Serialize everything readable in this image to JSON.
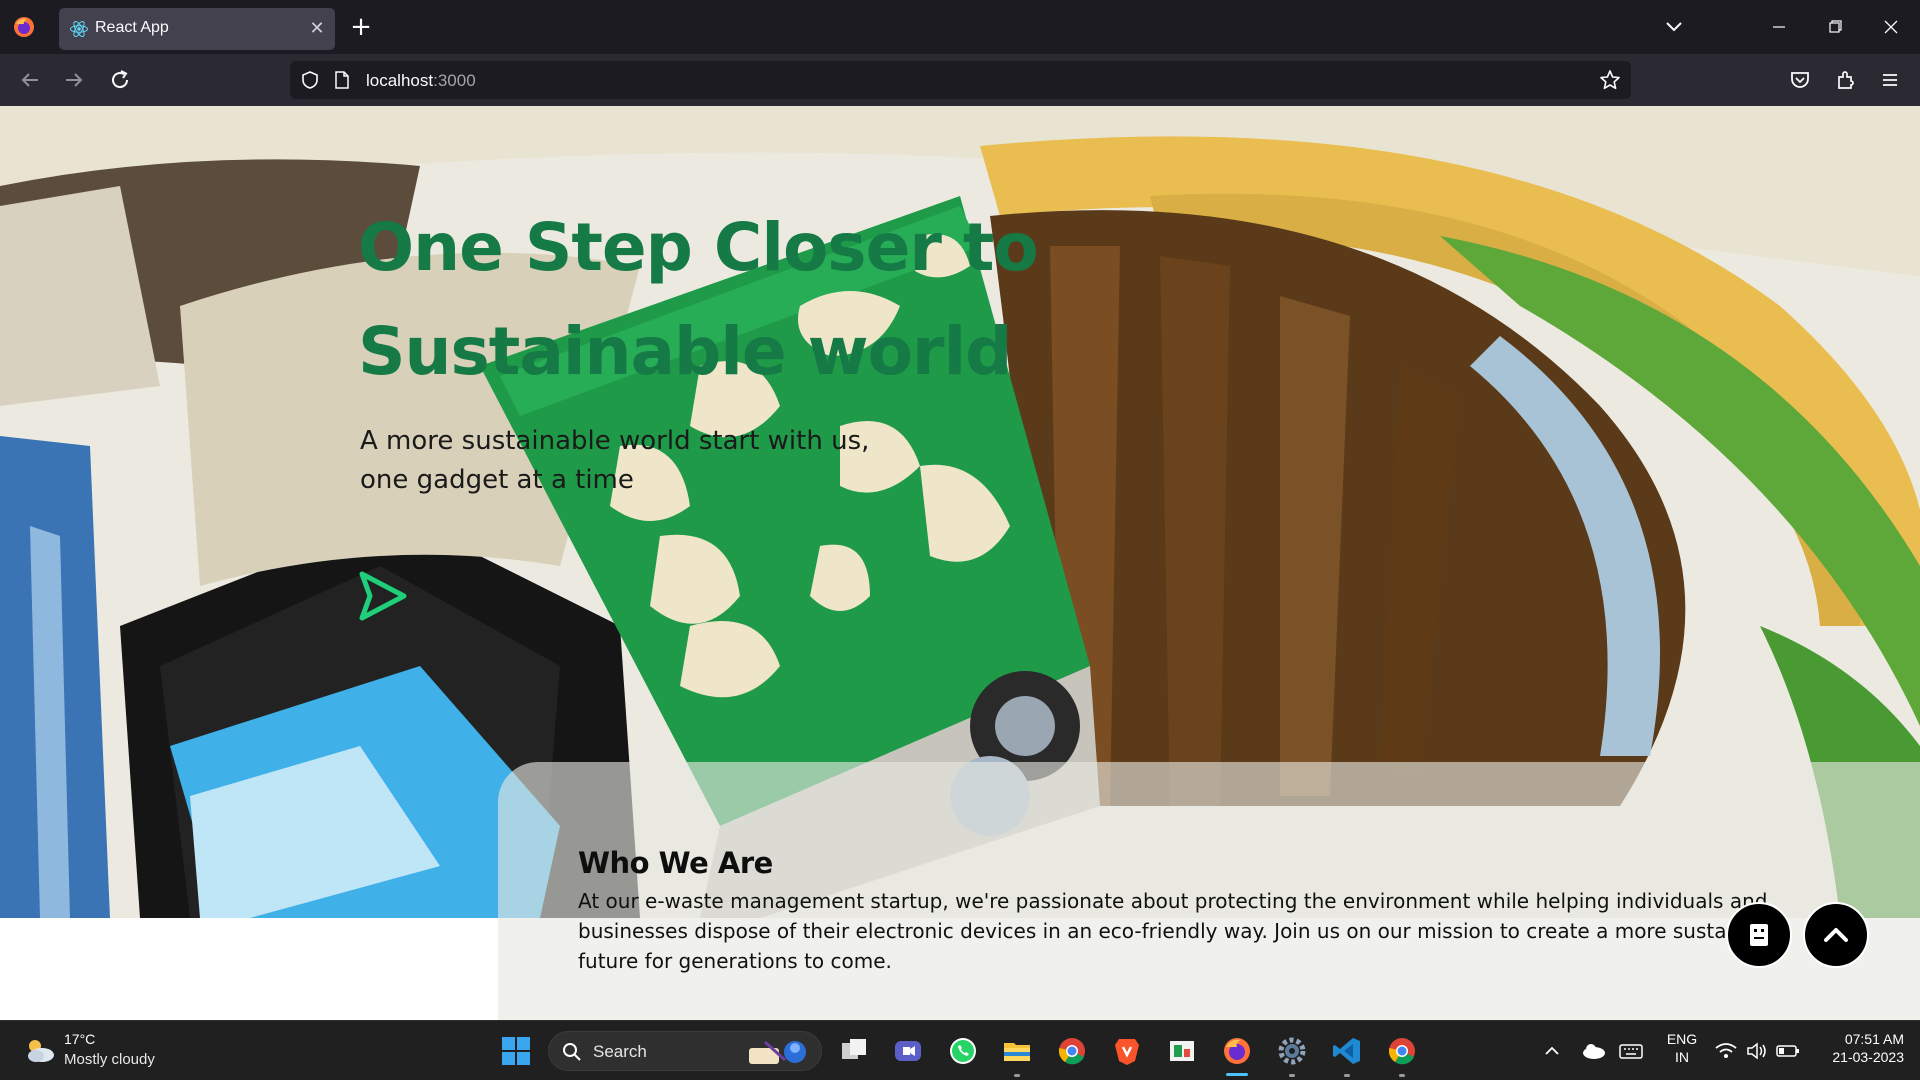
{
  "browser": {
    "tab_title": "React App",
    "url_host": "localhost",
    "url_port": ":3000"
  },
  "hero": {
    "title_line1": "One Step Closer to",
    "title_line2": "Sustainable world",
    "subtitle_line1": "A more sustainable world start with us,",
    "subtitle_line2": "one gadget at a time",
    "accent_color": "#157a45"
  },
  "who": {
    "title": "Who We Are",
    "text": "At our e-waste management startup, we're passionate about protecting the environment while helping individuals and businesses dispose of their electronic devices in an eco-friendly way. Join us on our mission to create a more sustainable future for generations to come."
  },
  "buttons": {
    "chat_icon": "chat-bot-icon",
    "scroll_top_icon": "chevron-up-icon"
  },
  "taskbar": {
    "weather_temp": "17°C",
    "weather_desc": "Mostly cloudy",
    "search_label": "Search",
    "language": "ENG",
    "region": "IN",
    "time": "07:51 AM",
    "date": "21-03-2023"
  }
}
